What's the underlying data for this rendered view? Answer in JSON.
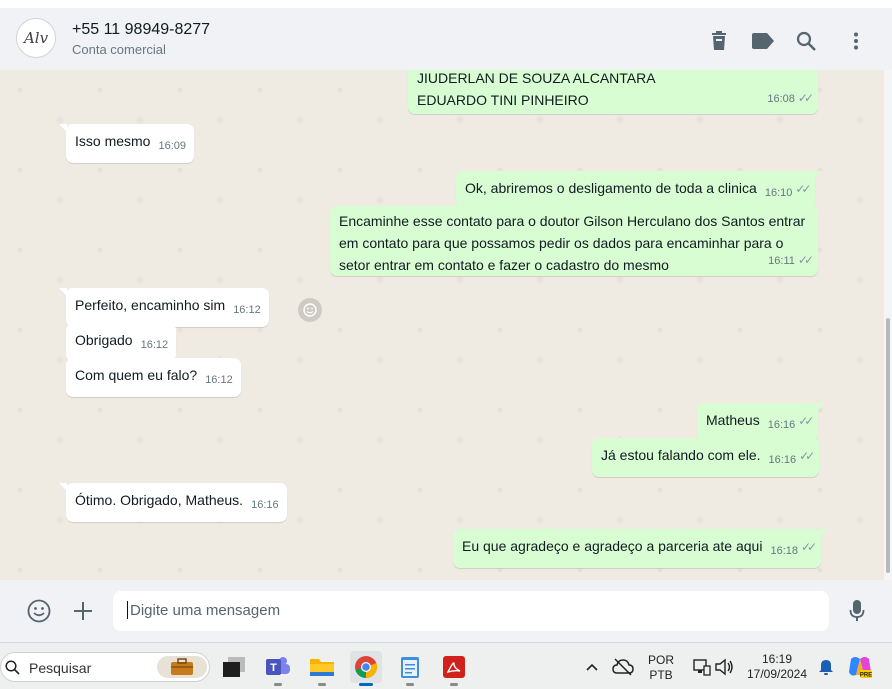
{
  "header": {
    "avatar_text": "Alv",
    "contact_name": "+55 11 98949-8277",
    "contact_subtitle": "Conta comercial",
    "icons": [
      "trash-icon",
      "label-icon",
      "search-icon",
      "menu-icon"
    ]
  },
  "messages": [
    {
      "dir": "out",
      "lines": [
        "JIUDERLAN DE SOUZA ALCANTARA",
        "EDUARDO TINI PINHEIRO"
      ],
      "time": "16:08"
    },
    {
      "dir": "in",
      "text": "Isso mesmo",
      "time": "16:09"
    },
    {
      "dir": "out",
      "text": "Ok, abriremos o desligamento de toda a clinica",
      "time": "16:10"
    },
    {
      "dir": "out",
      "lines": [
        "Encaminhe esse contato para o doutor Gilson Herculano dos Santos entrar",
        "em contato para que possamos pedir os dados para encaminhar para o",
        "setor entrar em contato e fazer o cadastro do mesmo"
      ],
      "time": "16:11"
    },
    {
      "dir": "in",
      "text": "Perfeito, encaminho sim",
      "time": "16:12"
    },
    {
      "dir": "in",
      "text": "Obrigado",
      "time": "16:12"
    },
    {
      "dir": "in",
      "text": "Com quem eu falo?",
      "time": "16:12"
    },
    {
      "dir": "out",
      "text": "Matheus",
      "time": "16:16"
    },
    {
      "dir": "out",
      "text": "Já estou falando com ele.",
      "time": "16:16"
    },
    {
      "dir": "in",
      "text": "Ótimo. Obrigado, Matheus.",
      "time": "16:16"
    },
    {
      "dir": "out",
      "text": "Eu que agradeço e agradeço a parceria ate aqui",
      "time": "16:18"
    }
  ],
  "composer": {
    "placeholder": "Digite uma mensagem",
    "icons": [
      "emoji-icon",
      "plus-icon",
      "microphone-icon"
    ]
  },
  "taskbar": {
    "search_label": "Pesquisar",
    "apps": [
      "briefcase",
      "terminal",
      "teams",
      "file-explorer",
      "chrome",
      "notepad",
      "pdf-reader"
    ],
    "language_top": "POR",
    "language_bottom": "PTB",
    "clock_time": "16:19",
    "clock_date": "17/09/2024"
  },
  "colors": {
    "outgoing_bubble": "#d9fdd3",
    "incoming_bubble": "#ffffff",
    "chat_background": "#efeae2",
    "header_background": "#f0f2f5"
  }
}
